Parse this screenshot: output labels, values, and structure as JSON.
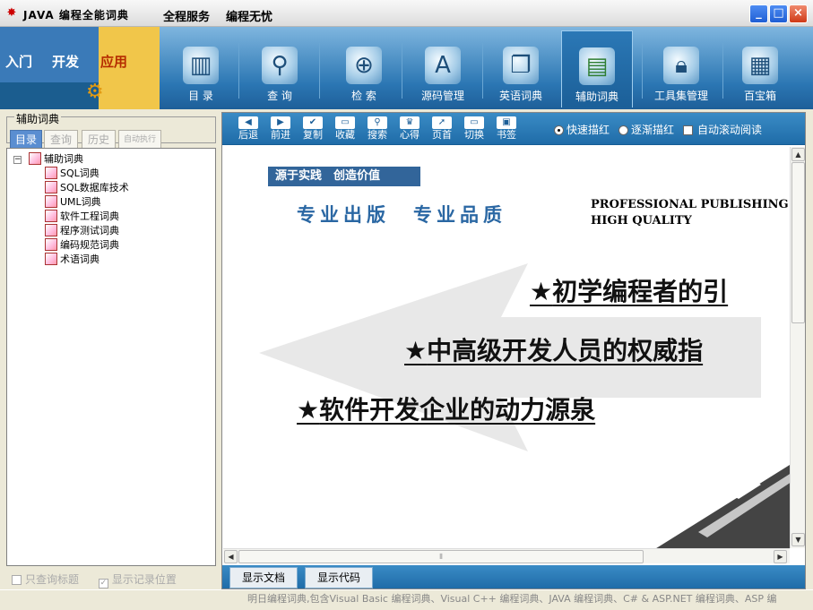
{
  "window": {
    "title": "JAVA 编程全能词典",
    "slogan1": "全程服务",
    "slogan2": "编程无忧",
    "minimize": "_",
    "maximize": "□",
    "close": "×"
  },
  "brand": {
    "tab1": "入门",
    "tab2": "开发",
    "tab3": "应用"
  },
  "nav": [
    {
      "label": "目 录",
      "icon": "book-icon"
    },
    {
      "label": "查 询",
      "icon": "magnifier-icon"
    },
    {
      "label": "检 索",
      "icon": "search-globe-icon"
    },
    {
      "label": "源码管理",
      "icon": "font-a-icon"
    },
    {
      "label": "英语词典",
      "icon": "open-book-icon"
    },
    {
      "label": "辅助词典",
      "icon": "notebook-icon"
    },
    {
      "label": "工具集管理",
      "icon": "lock-icon"
    },
    {
      "label": "百宝箱",
      "icon": "giftbox-icon"
    }
  ],
  "left": {
    "group_title": "辅助词典",
    "tabs": [
      "目录",
      "查询",
      "历史",
      "自动执行"
    ],
    "tree_root": "辅助词典",
    "tree_items": [
      "SQL词典",
      "SQL数据库技术",
      "UML词典",
      "软件工程词典",
      "程序测试词典",
      "编码规范词典",
      "术语词典"
    ],
    "check1": "只查询标题",
    "check2": "显示记录位置"
  },
  "toolbar": {
    "buttons": [
      "后退",
      "前进",
      "复制",
      "收藏",
      "搜索",
      "心得",
      "页首",
      "切换",
      "书签"
    ],
    "radio1": "快速描红",
    "radio2": "逐渐描红",
    "check": "自动滚动阅读"
  },
  "content": {
    "banner": "源于实践　创造价值",
    "subtitle_cn": "专业出版　专业品质",
    "subtitle_en1": "PROFESSIONAL PUBLISHING",
    "subtitle_en2": "HIGH QUALITY",
    "line1": "初学编程者的引",
    "line2": "中高级开发人员的权威指",
    "line3": "软件开发企业的动力源泉"
  },
  "bottom_tabs": [
    "显示文档",
    "显示代码"
  ],
  "status": "明日编程词典,包含Visual Basic 编程词典、Visual C++ 编程词典、JAVA 编程词典、C# & ASP.NET 编程词典、ASP 编",
  "colors": {
    "accent": "#2b76b3",
    "brand_gold": "#f1c64a",
    "active_tab": "#5a8ed1"
  }
}
